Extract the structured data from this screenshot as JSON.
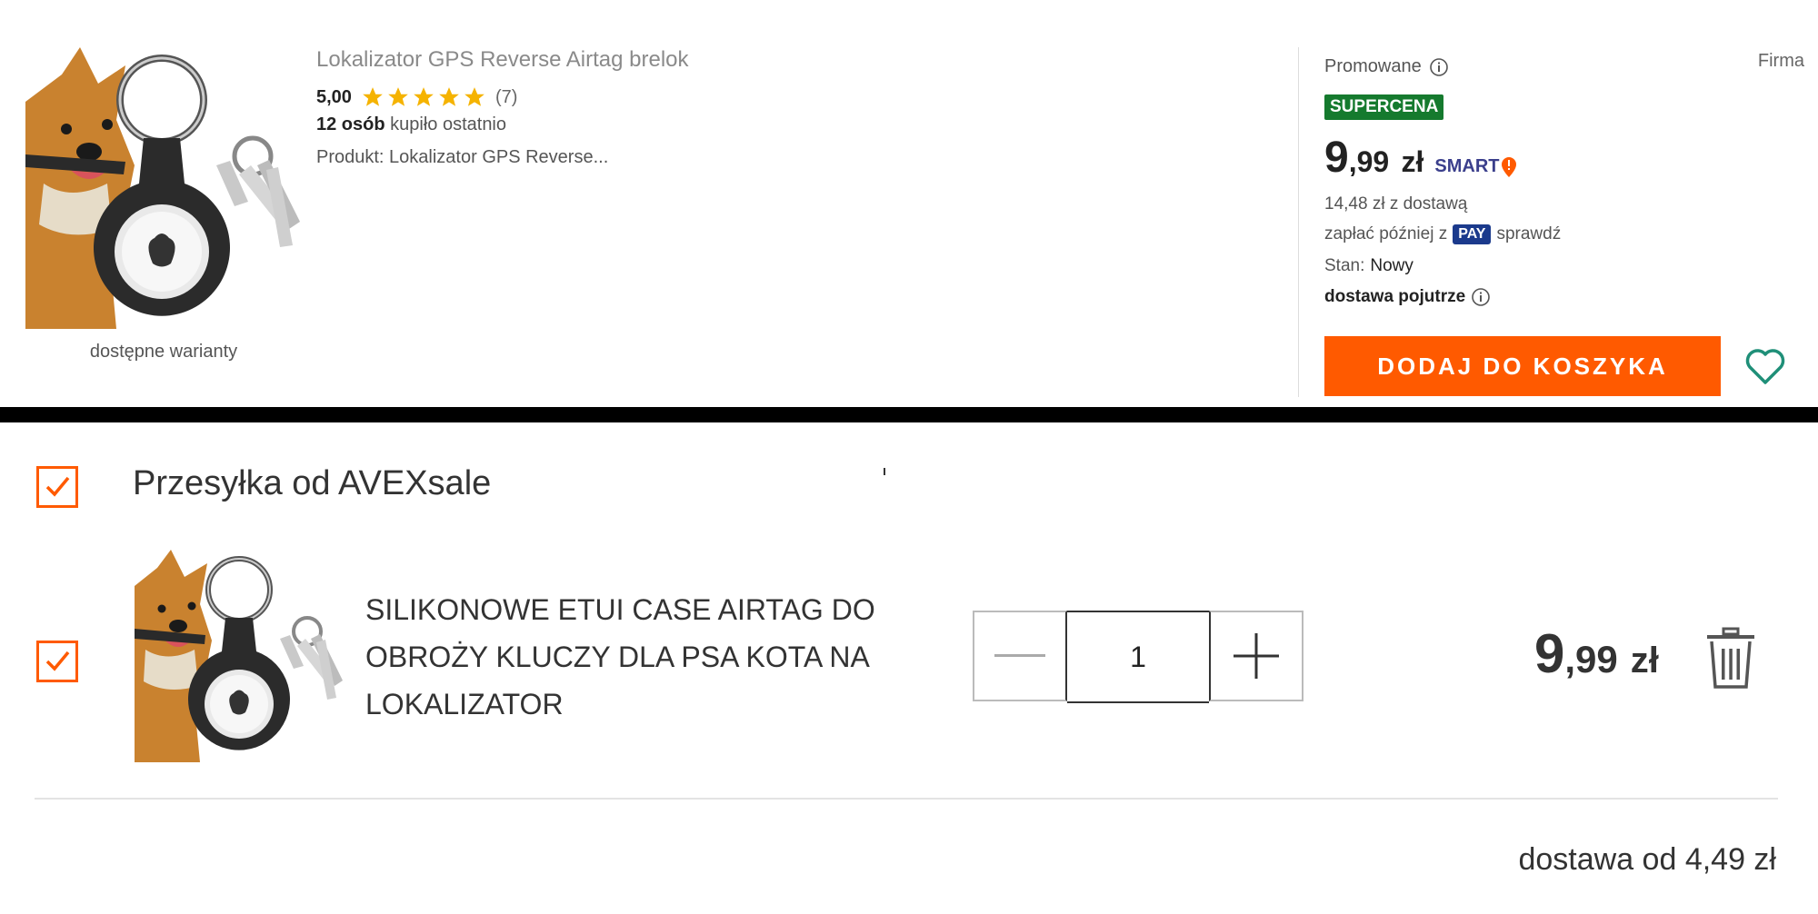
{
  "listing": {
    "title": "Lokalizator GPS Reverse Airtag brelok",
    "rating_score": "5,00",
    "rating_count": "(7)",
    "stars": 5,
    "bought_count": "12 osób",
    "bought_text": "kupiło ostatnio",
    "product_line": "Produkt: Lokalizator GPS Reverse...",
    "variants_label": "dostępne warianty",
    "promoted_label": "Promowane",
    "seller_type": "Firma",
    "badge": "SUPERCENA",
    "price_int": "9",
    "price_dec": ",99",
    "price_currency": "zł",
    "smart_label": "SMART",
    "with_delivery": "14,48 zł z dostawą",
    "pay_later_prefix": "zapłać później z",
    "pay_badge": "PAY",
    "pay_later_suffix": "sprawdź",
    "condition_label": "Stan:",
    "condition_value": "Nowy",
    "delivery_when": "dostawa pojutrze",
    "add_to_cart": "DODAJ DO KOSZYKA",
    "accent_color": "#ff5a00",
    "badge_color": "#157a2e"
  },
  "cart": {
    "seller_heading": "Przesyłka od AVEXsale",
    "item_title": "SILIKONOWE ETUI CASE AIRTAG DO OBROŻY KLUCZY DLA PSA KOTA NA LOKALIZATOR",
    "quantity": "1",
    "price_int": "9",
    "price_dec": ",99",
    "price_currency": "zł",
    "delivery_from": "dostawa od 4,49 zł"
  }
}
